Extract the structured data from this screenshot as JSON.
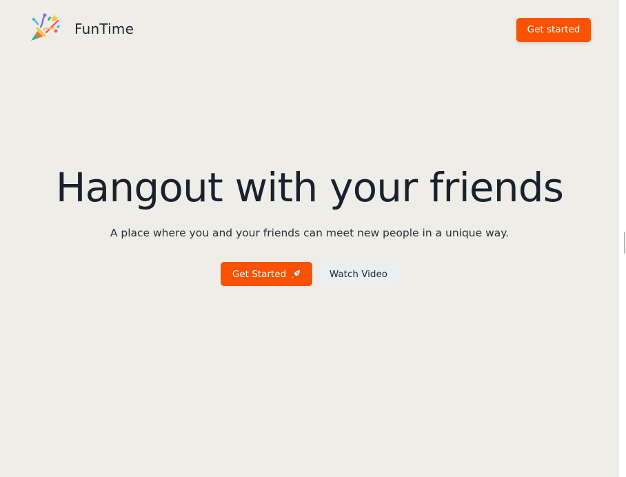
{
  "header": {
    "brand_name": "FunTime",
    "logo_icon": "party-popper-icon",
    "cta_label": "Get started"
  },
  "hero": {
    "title": "Hangout with your friends",
    "subtitle": "A place where you and your friends can meet new people in a unique way.",
    "primary_label": "Get Started",
    "primary_icon": "rocket-icon",
    "secondary_label": "Watch Video"
  },
  "colors": {
    "background": "#eeede8",
    "accent": "#f95200",
    "heading": "#1b212c",
    "secondary_button": "#edeef1"
  }
}
